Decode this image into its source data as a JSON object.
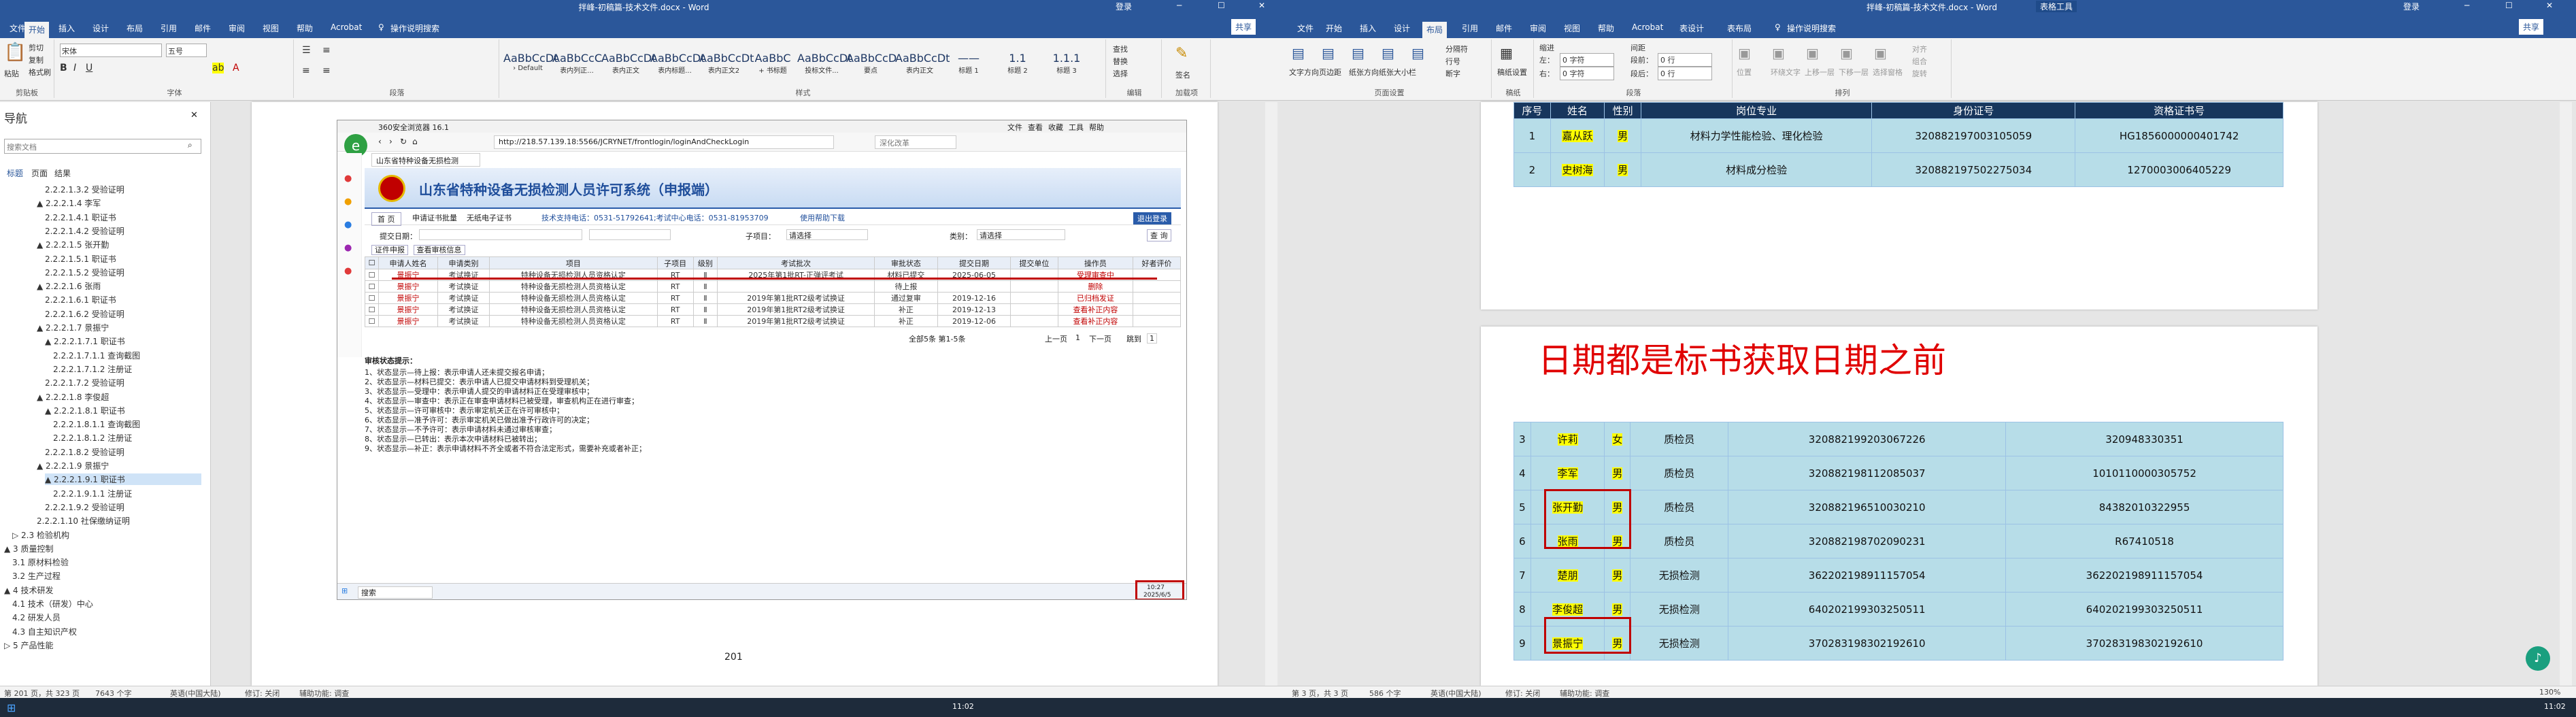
{
  "left": {
    "title": "拌峰-初稿篇-技术文件.docx - Word",
    "window_controls": [
      "登录",
      "─",
      "☐",
      "✕"
    ],
    "share": "共享",
    "tabs": [
      "文件",
      "开始",
      "插入",
      "设计",
      "布局",
      "引用",
      "邮件",
      "审阅",
      "视图",
      "帮助",
      "Acrobat",
      "♀",
      "操作说明搜索"
    ],
    "active_tab": 1,
    "clipboard": {
      "paste": "粘贴",
      "cut": "剪切",
      "copy": "复制",
      "painter": "格式刷",
      "label": "剪贴板"
    },
    "font": {
      "name": "宋体",
      "size": "五号",
      "label": "字体"
    },
    "paragraph_label": "段落",
    "styles": [
      {
        "sample": "AaBbCcDt",
        "name": "› Default"
      },
      {
        "sample": "AaBbCcC",
        "name": "表内列正..."
      },
      {
        "sample": "AaBbCcDt",
        "name": "表内正文"
      },
      {
        "sample": "AaBbCcDt",
        "name": "表内标题..."
      },
      {
        "sample": "AaBbCcDt",
        "name": "表内正文2"
      },
      {
        "sample": "AaBbC",
        "name": "+ 书标题"
      },
      {
        "sample": "AaBbCcDt",
        "name": "投标文件..."
      },
      {
        "sample": "AaBbCcD",
        "name": "要点"
      },
      {
        "sample": "AaBbCcDt",
        "name": "表内正文"
      },
      {
        "sample": "——",
        "name": "标题 1"
      },
      {
        "sample": "1.1",
        "name": "标题 2"
      },
      {
        "sample": "1.1.1",
        "name": "标题 3"
      }
    ],
    "styles_label": "样式",
    "editing": {
      "find": "查找",
      "replace": "替换",
      "select": "选择",
      "label": "编辑"
    },
    "addin": {
      "sign": "签名",
      "label": "加载项"
    },
    "nav": {
      "title": "导航",
      "search_placeholder": "搜索文档",
      "tabs": [
        "标题",
        "页面",
        "结果"
      ],
      "items": [
        "2.2.2.1.3.2 受验证明",
        "▲ 2.2.2.1.4 李军",
        "2.2.2.1.4.1 职证书",
        "2.2.2.1.4.2 受验证明",
        "▲ 2.2.2.1.5 张开勤",
        "2.2.2.1.5.1 职证书",
        "2.2.2.1.5.2 受验证明",
        "▲ 2.2.2.1.6 张雨",
        "2.2.2.1.6.1 职证书",
        "2.2.2.1.6.2 受验证明",
        "▲ 2.2.2.1.7 景振宁",
        "▲ 2.2.2.1.7.1 职证书",
        "2.2.2.1.7.1.1 查询截图",
        "2.2.2.1.7.1.2 注册证",
        "2.2.2.1.7.2 受验证明",
        "▲ 2.2.2.1.8 李俊超",
        "▲ 2.2.2.1.8.1 职证书",
        "2.2.2.1.8.1.1 查询截图",
        "2.2.2.1.8.1.2 注册证",
        "2.2.2.1.8.2 受验证明",
        "▲ 2.2.2.1.9 景振宁",
        "▲ 2.2.2.1.9.1 职证书",
        "2.2.2.1.9.1.1 注册证",
        "2.2.2.1.9.2 受验证明",
        "2.2.2.1.10 社保缴纳证明",
        "▷ 2.3 检验机构",
        "▲ 3 质量控制",
        "3.1 原材料检验",
        "3.2 生产过程",
        "▲ 4 技术研发",
        "4.1 技术（研发）中心",
        "4.2 研发人员",
        "4.3 自主知识产权",
        "▷ 5 产品性能"
      ],
      "selected": 21
    },
    "browser": {
      "app_name": "360安全浏览器 16.1",
      "menu": [
        "文件",
        "查看",
        "收藏",
        "工具",
        "帮助"
      ],
      "url": "http://218.57.139.18:5566/JCRYNET/frontlogin/loginAndCheckLogin",
      "search_hint": "深化改革",
      "tab_label": "山东省特种设备无损检测",
      "banner": "山东省特种设备无损检测人员许可系统（申报端）",
      "subnav": [
        "首 页",
        "申请证书批量",
        "无纸电子证书"
      ],
      "support": "技术支持电话：0531-51792641;考试中心电话：0531-81953709",
      "helpdoc": "使用帮助下载",
      "logout": "退出登录",
      "filters": {
        "apply_date": "提交日期：",
        "type_label": "子项目：",
        "type_value": "请选择",
        "cat_label": "类别：",
        "cat_value": "请选择",
        "query": "查 询"
      },
      "action_tabs": [
        "证件申报",
        "查看审核信息"
      ],
      "columns": [
        "申请人姓名",
        "申请类别",
        "项目",
        "子项目",
        "级别",
        "考试批次",
        "审批状态",
        "提交日期",
        "提交单位",
        "操作员",
        "好者评价"
      ],
      "rows": [
        [
          "景振宁",
          "考试换证",
          "特种设备无损检测人员资格认定",
          "RT",
          "Ⅱ",
          "2025年第1批RT-正弹评考试",
          "材料已提交",
          "2025-06-05",
          "",
          "受理审查中"
        ],
        [
          "景振宁",
          "考试换证",
          "特种设备无损检测人员资格认定",
          "RT",
          "Ⅱ",
          "",
          "待上报",
          "",
          "",
          "删除"
        ],
        [
          "景振宁",
          "考试换证",
          "特种设备无损检测人员资格认定",
          "RT",
          "Ⅱ",
          "2019年第1批RT2级考试换证",
          "通过复审",
          "2019-12-16",
          "",
          "已归档发证"
        ],
        [
          "景振宁",
          "考试换证",
          "特种设备无损检测人员资格认定",
          "RT",
          "Ⅱ",
          "2019年第1批RT2级考试换证",
          "补正",
          "2019-12-13",
          "",
          "查看补正内容"
        ],
        [
          "景振宁",
          "考试换证",
          "特种设备无损检测人员资格认定",
          "RT",
          "Ⅱ",
          "2019年第1批RT2级考试换证",
          "补正",
          "2019-12-06",
          "",
          "查看补正内容"
        ]
      ],
      "pager": "全部5条 第1-5条",
      "pager_btns": [
        "上一页",
        "1",
        "下一页",
        "跳到",
        "1"
      ],
      "notes_title": "审核状态提示：",
      "notes": [
        "1、状态显示—待上报：表示申请人还未提交报名申请；",
        "2、状态显示—材料已提交：表示申请人已提交申请材料到受理机关；",
        "3、状态显示—受理中：表示申请人提交的申请材料正在受理审核中；",
        "4、状态显示—审查中：表示正在审查申请材料已被受理，审查机构正在进行审查；",
        "5、状态显示—许可审核中：表示审定机关正在许可审核中；",
        "6、状态显示—准予许可：表示审定机关已做出准予行政许可的决定；",
        "7、状态显示—不予许可：表示申请材料未通过审核审查；",
        "8、状态显示—已转出：表示本次申请材料已被转出；",
        "9、状态显示—补正：表示申请材料不齐全或者不符合法定形式，需要补充或者补正；"
      ],
      "inner_taskbar_search": "搜索",
      "inner_clock": [
        "10:27",
        "2025/6/5"
      ]
    },
    "page_number": "201",
    "status": {
      "page": "第 201 页，共 323 页",
      "words": "7643 个字",
      "lang": "英语(中国大陆)",
      "edit": "修订: 关闭",
      "access": "辅助功能: 调查"
    }
  },
  "right": {
    "title": "拌峰-初稿篇-技术文件.docx - Word",
    "table_tools": "表格工具",
    "window_controls": [
      "登录",
      "─",
      "☐",
      "✕"
    ],
    "share": "共享",
    "tabs": [
      "文件",
      "开始",
      "插入",
      "设计",
      "布局",
      "引用",
      "邮件",
      "审阅",
      "视图",
      "帮助",
      "Acrobat",
      "表设计",
      "表布局",
      "♀",
      "操作说明搜索"
    ],
    "active_tab": 4,
    "ribbon": {
      "page_setup": [
        "文字方向",
        "页边距",
        "纸张方向",
        "纸张大小",
        "栏"
      ],
      "page_setup_label": "页面设置",
      "extra": [
        "分隔符",
        "行号",
        "断字"
      ],
      "draft": "稿纸设置",
      "draft_label": "稿纸",
      "indent": {
        "title": "缩进",
        "left": "左：",
        "left_val": "0 字符",
        "right": "右：",
        "right_val": "0 字符"
      },
      "spacing": {
        "title": "间距",
        "before": "段前：",
        "before_val": "0 行",
        "after": "段后：",
        "after_val": "0 行"
      },
      "paragraph_label": "段落",
      "arrange": [
        "位置",
        "环绕文字",
        "上移一层",
        "下移一层",
        "选择窗格",
        "对齐",
        "组合",
        "旋转"
      ],
      "arrange_label": "排列"
    },
    "table_top": {
      "header": [
        "序号",
        "姓名",
        "性别",
        "岗位专业",
        "身份证号",
        "资格证书号"
      ],
      "rows": [
        [
          "1",
          "嘉从跃",
          "男",
          "材料力学性能检验、理化检验",
          "320882197003105059",
          "HG1856000000401742"
        ],
        [
          "2",
          "史树海",
          "男",
          "材料成分检验",
          "320882197502275034",
          "1270003006405229"
        ]
      ]
    },
    "annotation": "日期都是标书获取日期之前",
    "table_bottom": {
      "rows": [
        [
          "3",
          "许莉",
          "女",
          "质检员",
          "320882199203067226",
          "320948330351"
        ],
        [
          "4",
          "李军",
          "男",
          "质检员",
          "320882198112085037",
          "1010110000305752"
        ],
        [
          "5",
          "张开勤",
          "男",
          "质检员",
          "320882196510030210",
          "84382010322955"
        ],
        [
          "6",
          "张雨",
          "男",
          "质检员",
          "320882198702090231",
          "R67410518"
        ],
        [
          "7",
          "楚朋",
          "男",
          "无损检测",
          "362202198911157054",
          "362202198911157054"
        ],
        [
          "8",
          "李俊超",
          "男",
          "无损检测",
          "640202199303250511",
          "640202199303250511"
        ],
        [
          "9",
          "景振宁",
          "男",
          "无损检测",
          "370283198302192610",
          "370283198302192610"
        ]
      ]
    },
    "status": {
      "page": "第 3 页，共 3 页",
      "words": "586 个字",
      "lang": "英语(中国大陆)",
      "edit": "修订: 关闭",
      "access": "辅助功能: 调查",
      "zoom": "130%"
    }
  },
  "taskbar": {
    "clock_left": "11:02",
    "clock_right": "11:02"
  },
  "colors": {
    "word_blue": "#2b579a",
    "highlight": "#ffff00",
    "red": "#c00000",
    "table_fill": "#b7dde8"
  }
}
